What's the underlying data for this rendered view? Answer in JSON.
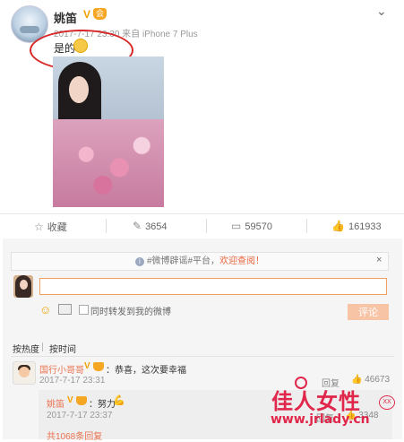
{
  "post": {
    "username": "姚笛",
    "verified_badge": "V",
    "member_badge": "会",
    "timestamp": "2017-7-17 23:30 来自 iPhone 7 Plus",
    "text": "是的",
    "more_icon": "chevron-down-icon"
  },
  "actions": {
    "favorite_label": "收藏",
    "repost_count": "3654",
    "comment_count": "59570",
    "like_count": "161933"
  },
  "notice": {
    "icon": "info-icon",
    "prefix": "#微博辟谣#平台，",
    "highlight": "欢迎查阅！",
    "close_label": "×"
  },
  "comment_box": {
    "input_value": "",
    "sync_label": "同时转发到我的微博",
    "submit_label": "评论"
  },
  "sort": {
    "hot_label": "按热度",
    "time_label": "按时间"
  },
  "comments": [
    {
      "name": "国行小哥哥",
      "text": "：恭喜，这次要幸福",
      "time": "2017-7-17 23:31",
      "reply_label": "回复",
      "like_count": "46673"
    }
  ],
  "reply": {
    "name": "姚笛",
    "text": "：努力",
    "time": "2017-7-17 23:37",
    "reply_label": "回复",
    "like_count": "3348",
    "more_text": "共1068条回复"
  },
  "watermark": {
    "title": "佳人女性",
    "url": "www.jrlady.cn",
    "badge": "XX"
  },
  "colors": {
    "accent_orange": "#eb7350",
    "badge_gold": "#f4a000",
    "highlight_ellipse": "#d62828",
    "watermark_red": "#e0264a"
  }
}
